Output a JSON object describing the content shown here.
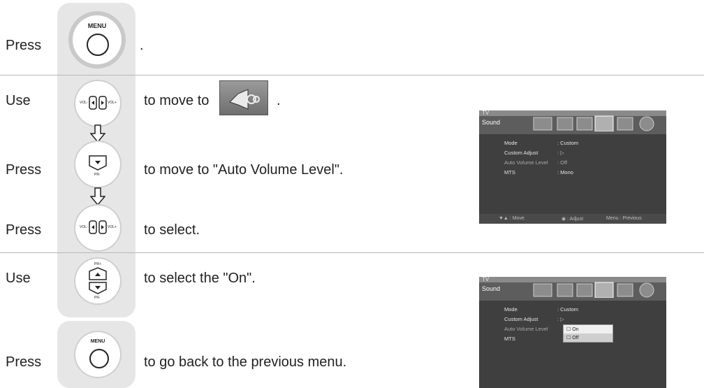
{
  "steps": {
    "s1": {
      "verb": "Press",
      "text": "."
    },
    "s2": {
      "verb": "Use",
      "text": "to move to",
      "after": "."
    },
    "s3": {
      "verb": "Press",
      "text": "to move to  \"Auto Volume Level\"."
    },
    "s4": {
      "verb": "Press",
      "text": "to select."
    },
    "s5": {
      "verb": "Use",
      "text": "to select the \"On\"."
    },
    "s6": {
      "verb": "Press",
      "text": "to go back to the previous menu."
    }
  },
  "buttons": {
    "menu_label": "MENU",
    "vol_left": "VOL-",
    "vol_right": "VOL+",
    "pr_minus": "PR-",
    "pr_plus": "PR+"
  },
  "screen": {
    "tv_label": "TV",
    "title": "Sound",
    "rows": [
      {
        "label": "Mode",
        "value": ": Custom"
      },
      {
        "label": "Custom Adjust",
        "value": ": ▷"
      },
      {
        "label": "Auto Volume Level",
        "value": ": Off"
      },
      {
        "label": "MTS",
        "value": ": Mono"
      }
    ],
    "footer": {
      "move": "▼▲ : Move",
      "adjust": "◉ : Adjust",
      "menu": "Menu : Previous"
    },
    "popup": [
      "On",
      "Off"
    ]
  },
  "colors": {
    "panel_bg": "#e6e6e6",
    "divider": "#b8b8b8",
    "screen_bg": "#3f3f3f"
  }
}
